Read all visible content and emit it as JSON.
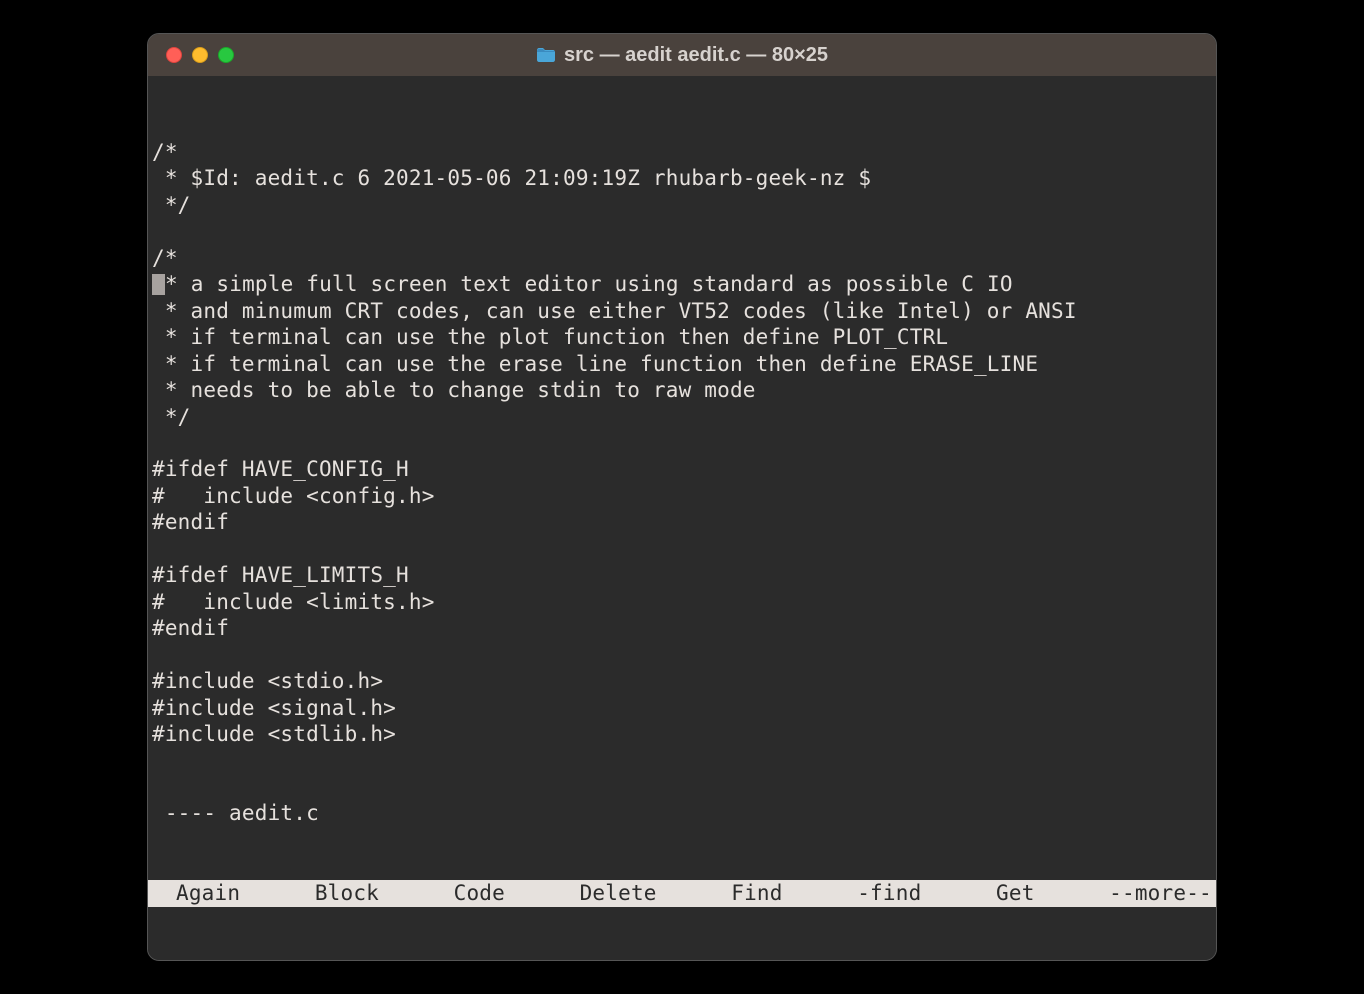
{
  "window": {
    "title": "src — aedit aedit.c — 80×25"
  },
  "code_lines": [
    "/*",
    " * $Id: aedit.c 6 2021-05-06 21:09:19Z rhubarb-geek-nz $",
    " */",
    "",
    "/*",
    " * a simple full screen text editor using standard as possible C IO",
    " * and minumum CRT codes, can use either VT52 codes (like Intel) or ANSI",
    " * if terminal can use the plot function then define PLOT_CTRL",
    " * if terminal can use the erase line function then define ERASE_LINE",
    " * needs to be able to change stdin to raw mode",
    " */",
    "",
    "#ifdef HAVE_CONFIG_H",
    "#   include <config.h>",
    "#endif",
    "",
    "#ifdef HAVE_LIMITS_H",
    "#   include <limits.h>",
    "#endif",
    "",
    "#include <stdio.h>",
    "#include <signal.h>",
    "#include <stdlib.h>"
  ],
  "cursor_line_index": 5,
  "status_line": " ---- aedit.c",
  "menu": {
    "again": "Again",
    "block": "Block",
    "code": "Code",
    "delete": "Delete",
    "find": "Find",
    "rfind": "-find",
    "get": "Get",
    "more": "--more--"
  }
}
